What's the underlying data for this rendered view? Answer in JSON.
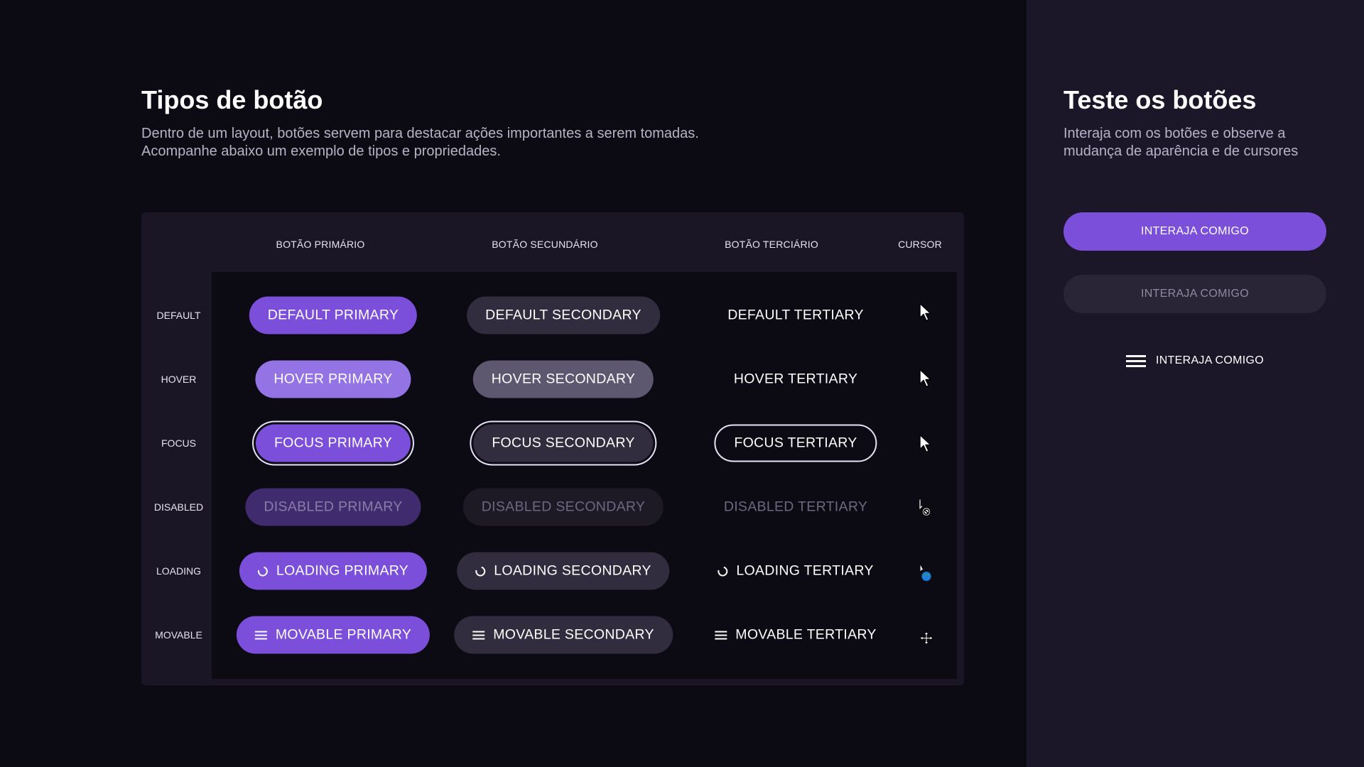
{
  "main": {
    "title": "Tipos de botão",
    "description_line1": "Dentro de um layout, botões servem para destacar ações importantes a serem tomadas.",
    "description_line2": "Acompanhe abaixo um exemplo de tipos e propriedades."
  },
  "table": {
    "headers": {
      "primary": "BOTÃO PRIMÁRIO",
      "secondary": "BOTÃO SECUNDÁRIO",
      "tertiary": "BOTÃO TERCIÁRIO",
      "cursor": "CURSOR"
    },
    "rows": [
      {
        "state": "DEFAULT",
        "primary": "DEFAULT PRIMARY",
        "secondary": "DEFAULT SECONDARY",
        "tertiary": "DEFAULT TERTIARY",
        "cursor_icon": "arrow-pointer-icon"
      },
      {
        "state": "HOVER",
        "primary": "HOVER PRIMARY",
        "secondary": "HOVER SECONDARY",
        "tertiary": "HOVER TERTIARY",
        "cursor_icon": "arrow-pointer-icon"
      },
      {
        "state": "FOCUS",
        "primary": "FOCUS PRIMARY",
        "secondary": "FOCUS SECONDARY",
        "tertiary": "FOCUS TERTIARY",
        "cursor_icon": "arrow-pointer-icon"
      },
      {
        "state": "DISABLED",
        "primary": "DISABLED PRIMARY",
        "secondary": "DISABLED SECONDARY",
        "tertiary": "DISABLED TERTIARY",
        "cursor_icon": "not-allowed-icon"
      },
      {
        "state": "LOADING",
        "primary": "LOADING PRIMARY",
        "secondary": "LOADING SECONDARY",
        "tertiary": "LOADING TERTIARY",
        "cursor_icon": "progress-cursor-icon"
      },
      {
        "state": "MOVABLE",
        "primary": "MOVABLE PRIMARY",
        "secondary": "MOVABLE SECONDARY",
        "tertiary": "MOVABLE TERTIARY",
        "cursor_icon": "move-cursor-icon"
      }
    ]
  },
  "sidebar": {
    "title": "Teste os botões",
    "description_line1": "Interaja com os botões e observe a",
    "description_line2": "mudança de aparência e de cursores",
    "primary_button": "INTERAJA COMIGO",
    "secondary_button": "INTERAJA COMIGO",
    "tertiary_button": "INTERAJA COMIGO"
  },
  "colors": {
    "background": "#0c0b14",
    "sidebar_background": "#1b1628",
    "primary": "#7b4fd9",
    "primary_hover": "#9473e4",
    "primary_disabled": "#3f2b6e",
    "secondary": "#322d3e",
    "secondary_hover": "#5e5770",
    "focus_ring": "#e8e2f7"
  }
}
